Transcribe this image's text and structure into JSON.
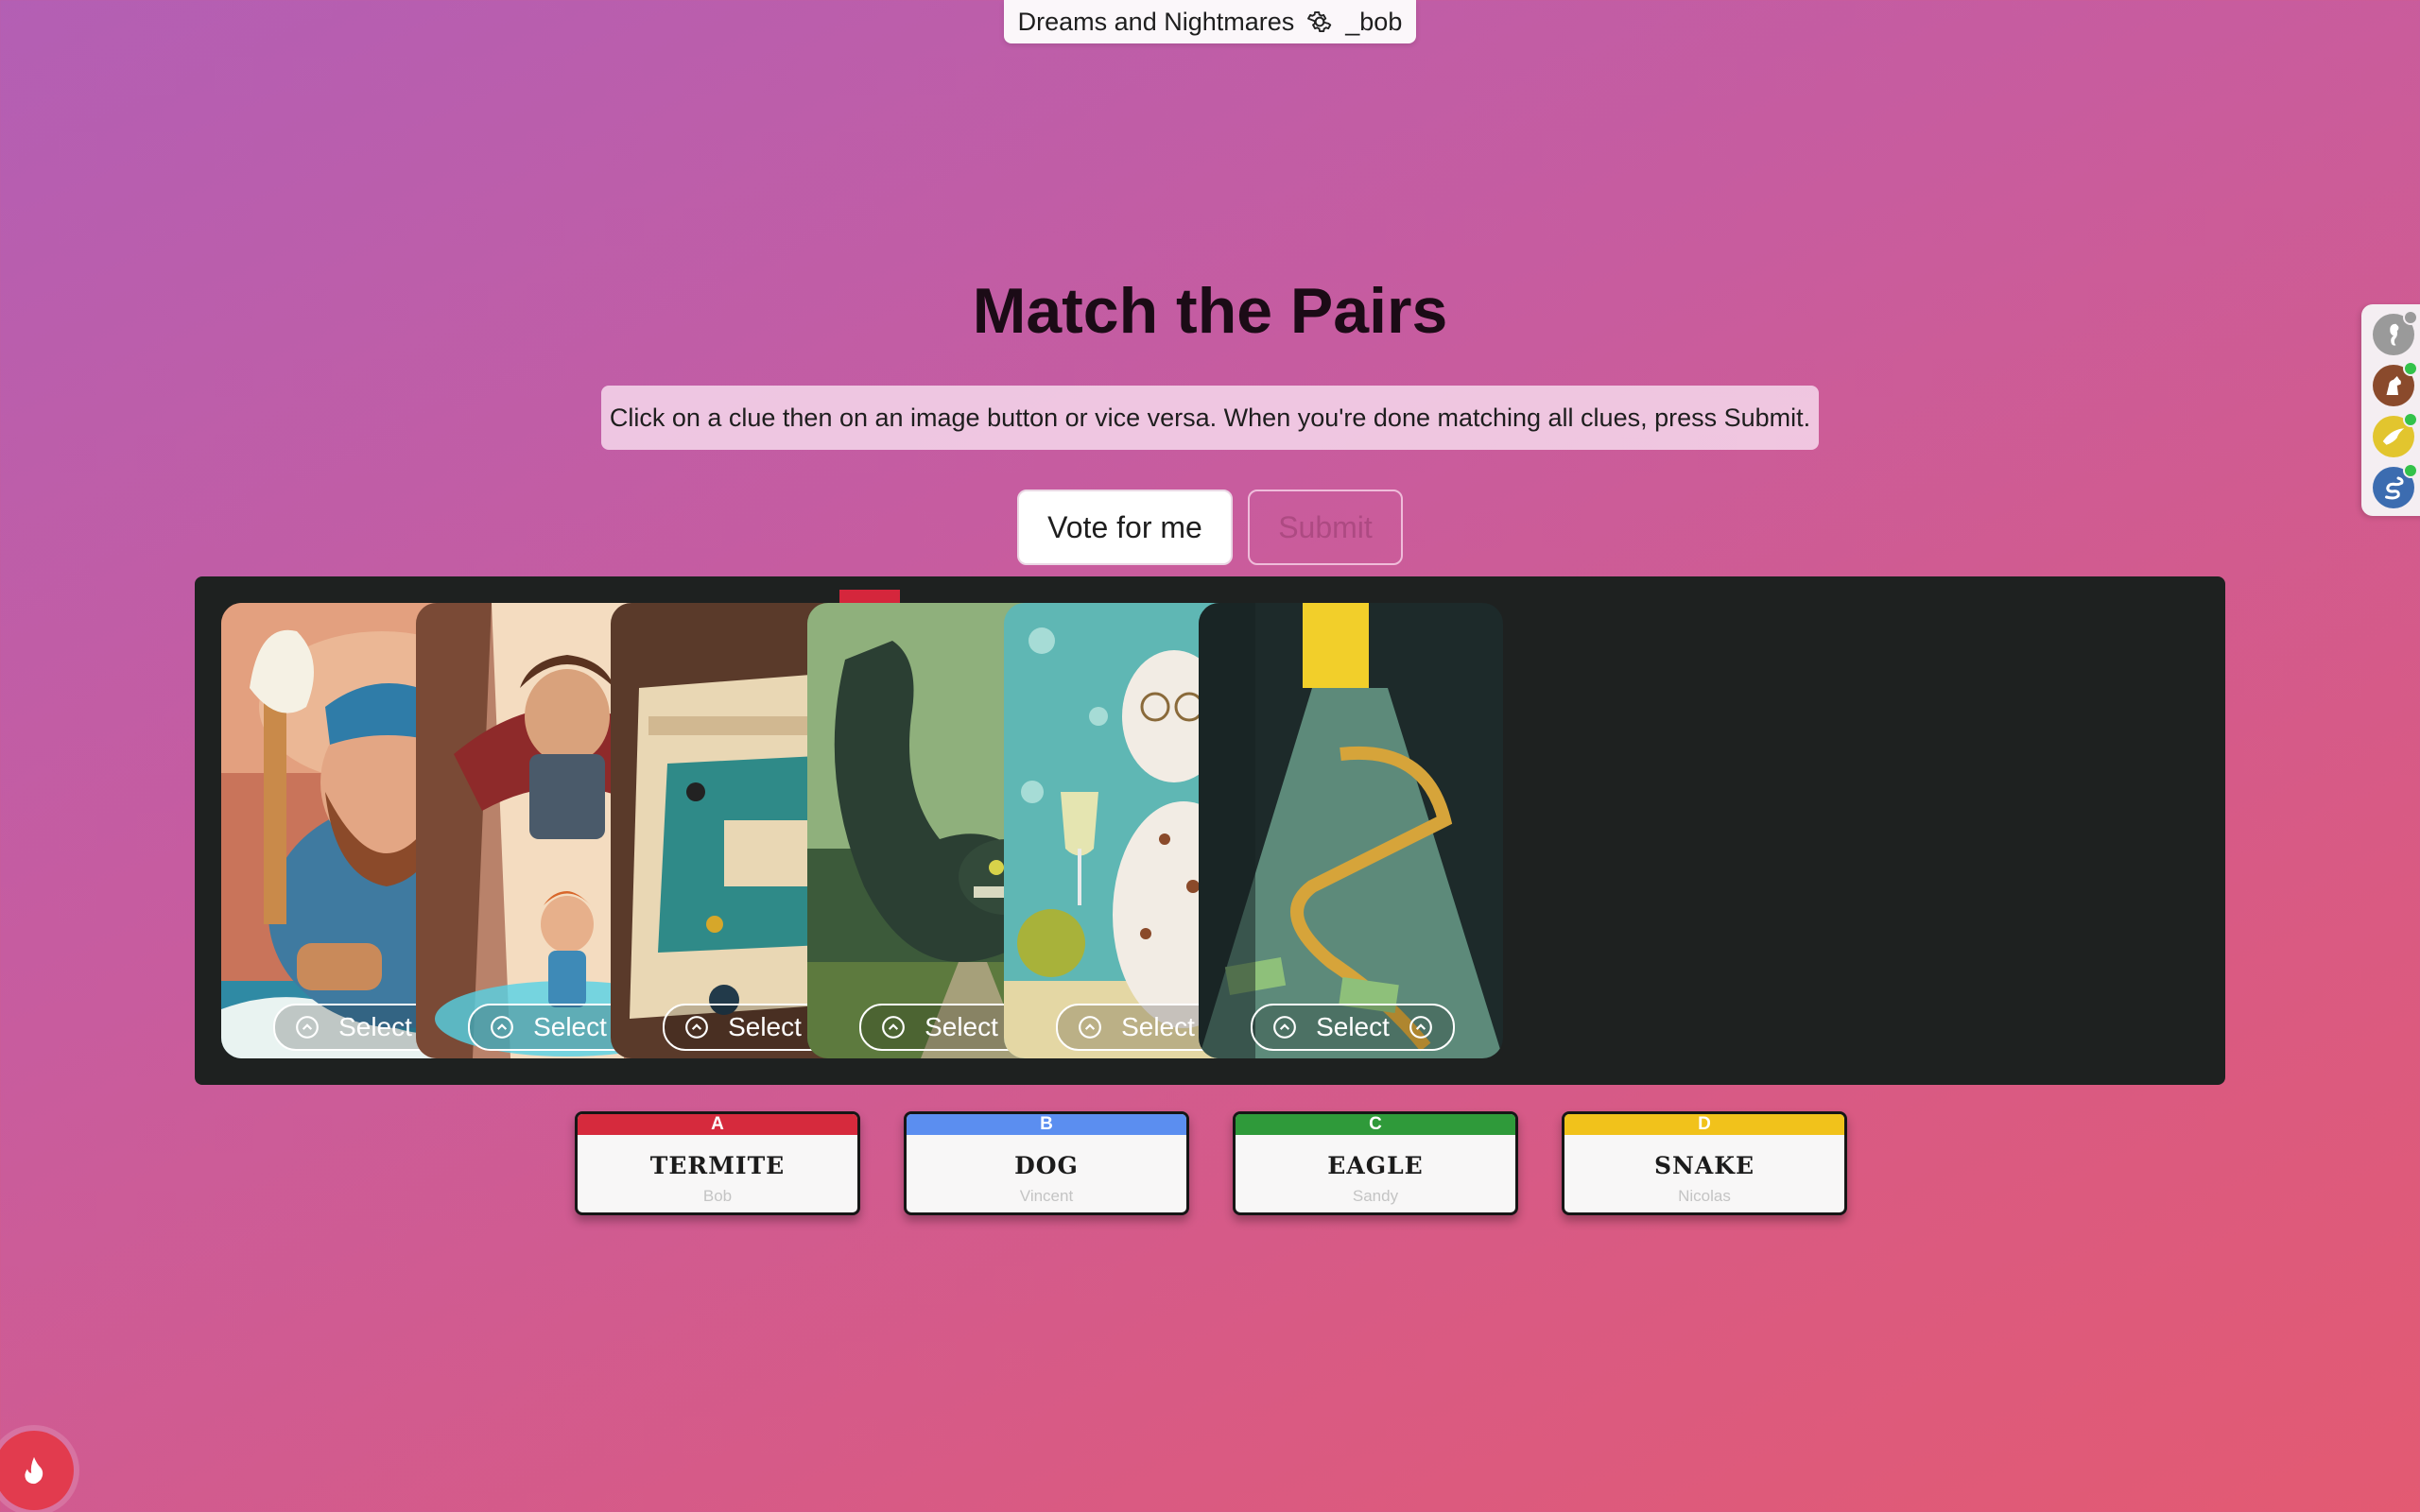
{
  "topbar": {
    "game_name": "Dreams and Nightmares",
    "username": "_bob"
  },
  "heading": "Match the Pairs",
  "instructions": "Click on a clue then on an image button or vice versa. When you're done matching all clues, press Submit.",
  "buttons": {
    "vote": "Vote for me",
    "submit": "Submit"
  },
  "cards": [
    {
      "select_label": "Select",
      "icon": "chevron-up-circle-icon",
      "assigned": ""
    },
    {
      "select_label": "Select",
      "icon": "chevron-up-circle-icon",
      "assigned": ""
    },
    {
      "select_label": "Select",
      "icon": "chevron-up-circle-icon",
      "assigned": "A"
    },
    {
      "select_label": "Select",
      "icon": "chevron-up-circle-icon",
      "assigned": ""
    },
    {
      "select_label": "Select",
      "icon": "chevron-up-circle-icon",
      "assigned": ""
    },
    {
      "select_label": "Select",
      "icon": "chevron-up-circle-icon",
      "assigned": ""
    }
  ],
  "clues": [
    {
      "letter": "A",
      "word": "TERMITE",
      "author": "Bob",
      "color": "#d62a3d"
    },
    {
      "letter": "B",
      "word": "DOG",
      "author": "Vincent",
      "color": "#5b8ef0"
    },
    {
      "letter": "C",
      "word": "EAGLE",
      "author": "Sandy",
      "color": "#2f9a3a"
    },
    {
      "letter": "D",
      "word": "SNAKE",
      "author": "Nicolas",
      "color": "#f1c21b"
    }
  ],
  "players": [
    {
      "icon": "seahorse-icon",
      "color": "#9a9a9a",
      "status": "#9a9a9a"
    },
    {
      "icon": "dog-icon",
      "color": "#8a4a2c",
      "status": "#33c24a"
    },
    {
      "icon": "eagle-icon",
      "color": "#e2c52e",
      "status": "#33c24a"
    },
    {
      "icon": "snake-icon",
      "color": "#3c6cb0",
      "status": "#33c24a"
    }
  ],
  "colors": {
    "accent_red": "#d5263c",
    "board": "#1e2120"
  }
}
